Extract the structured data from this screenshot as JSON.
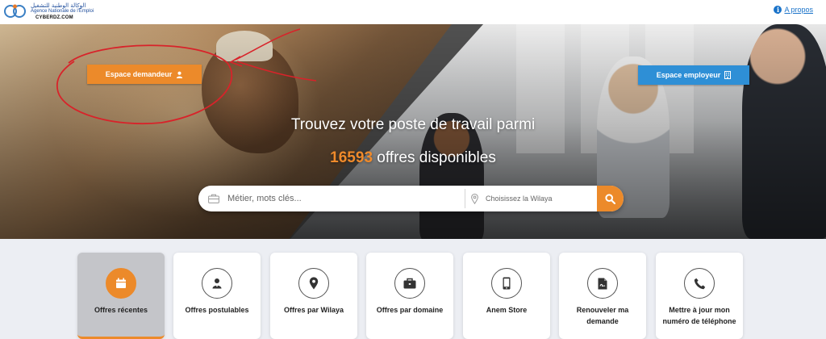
{
  "header": {
    "logo_ar": "الوكالة الوطنية للتشغيل",
    "logo_fr": "Agence Nationale de l'Emploi",
    "watermark": "CYBERDZ.COM",
    "apropos_label": "A propos"
  },
  "hero": {
    "btn_demandeur": "Espace demandeur",
    "btn_employeur": "Espace employeur",
    "title": "Trouvez votre poste de travail parmi",
    "offers_count": "16593",
    "offers_suffix": " offres disponibles"
  },
  "search": {
    "job_placeholder": "Métier, mots clés...",
    "wilaya_placeholder": "Choisissez la Wilaya"
  },
  "cards": [
    {
      "label": "Offres récentes",
      "icon": "calendar-icon",
      "active": true
    },
    {
      "label": "Offres postulables",
      "icon": "user-icon",
      "active": false
    },
    {
      "label": "Offres par Wilaya",
      "icon": "map-marker-icon",
      "active": false
    },
    {
      "label": "Offres par domaine",
      "icon": "briefcase-icon",
      "active": false
    },
    {
      "label": "Anem Store",
      "icon": "mobile-icon",
      "active": false
    },
    {
      "label": "Renouveler ma demande",
      "icon": "document-icon",
      "active": false
    },
    {
      "label": "Mettre à jour mon numéro de téléphone",
      "icon": "phone-icon",
      "active": false
    }
  ],
  "colors": {
    "accent_orange": "#ec8a2a",
    "accent_blue": "#2e8fd6",
    "link_blue": "#1a73c9",
    "annotation_red": "#d8232a"
  }
}
